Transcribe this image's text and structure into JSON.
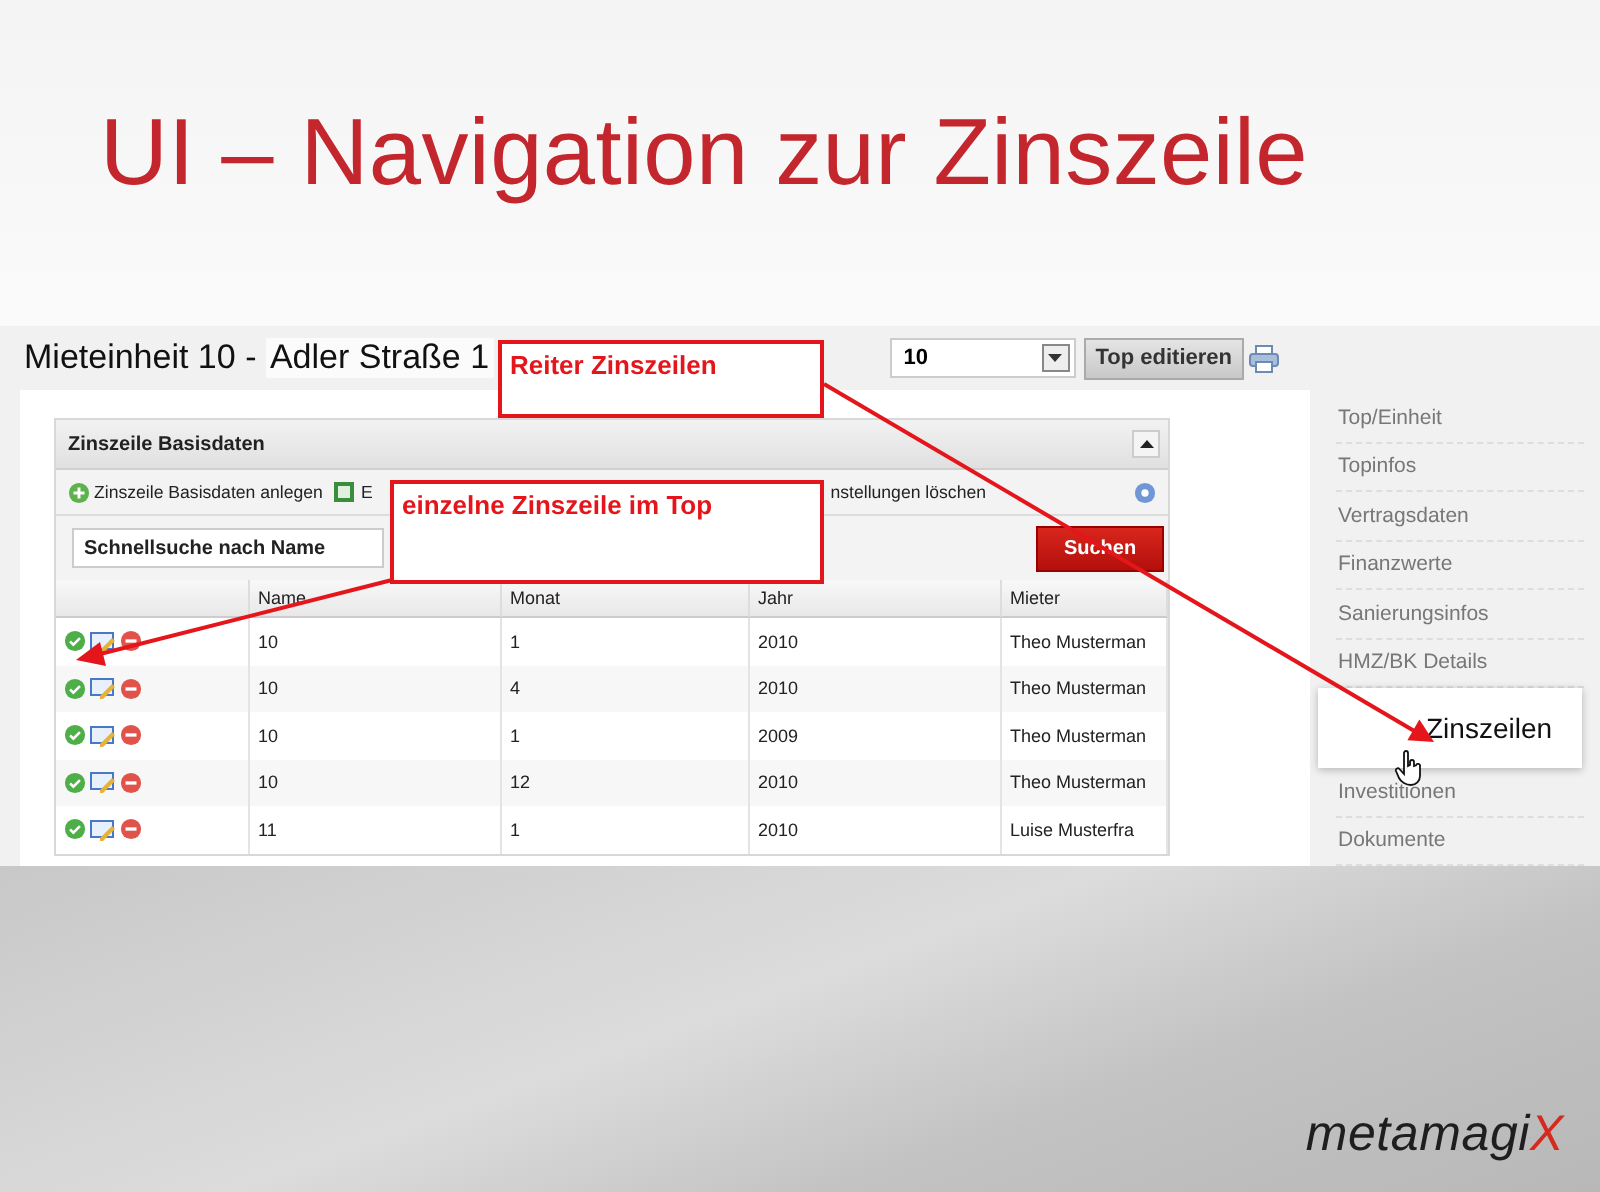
{
  "slide": {
    "title": "UI – Navigation zur Zinszeile",
    "logo": "metamagiX"
  },
  "header": {
    "label": "Mieteinheit 10 - ",
    "address": "Adler Straße 1",
    "select_value": "10",
    "edit_button": "Top editieren"
  },
  "panel": {
    "title": "Zinszeile Basisdaten",
    "search_placeholder": "Schnellsuche nach Name",
    "search_button": "Suchen",
    "toolbar": [
      {
        "kind": "add",
        "label": "Zinszeile Basisdaten anlegen"
      },
      {
        "kind": "export",
        "label": "E"
      },
      {
        "kind": "text",
        "label": "nstellungen löschen"
      }
    ]
  },
  "table": {
    "columns": [
      "Name",
      "Monat",
      "Jahr",
      "Mieter"
    ],
    "rows": [
      {
        "cells": [
          "10",
          "1",
          "2010",
          "Theo Musterman"
        ]
      },
      {
        "cells": [
          "10",
          "4",
          "2010",
          "Theo Musterman"
        ]
      },
      {
        "cells": [
          "10",
          "1",
          "2009",
          "Theo Musterman"
        ]
      },
      {
        "cells": [
          "10",
          "12",
          "2010",
          "Theo Musterman"
        ]
      },
      {
        "cells": [
          "11",
          "1",
          "2010",
          "Luise Musterfra"
        ]
      }
    ]
  },
  "nav": [
    {
      "label": "Top/Einheit",
      "selected": false
    },
    {
      "label": "Topinfos",
      "selected": false
    },
    {
      "label": "Vertragsdaten",
      "selected": false
    },
    {
      "label": "Finanzwerte",
      "selected": false
    },
    {
      "label": "Sanierungsinfos",
      "selected": false
    },
    {
      "label": "HMZ/BK Details",
      "selected": false
    },
    {
      "label": "Zinszeilen",
      "selected": true
    },
    {
      "label": "Investitionen",
      "selected": false
    },
    {
      "label": "Dokumente",
      "selected": false
    }
  ],
  "annotations": [
    {
      "text": "Reiter Zinszeilen"
    },
    {
      "text": "einzelne Zinszeile im Top"
    }
  ]
}
